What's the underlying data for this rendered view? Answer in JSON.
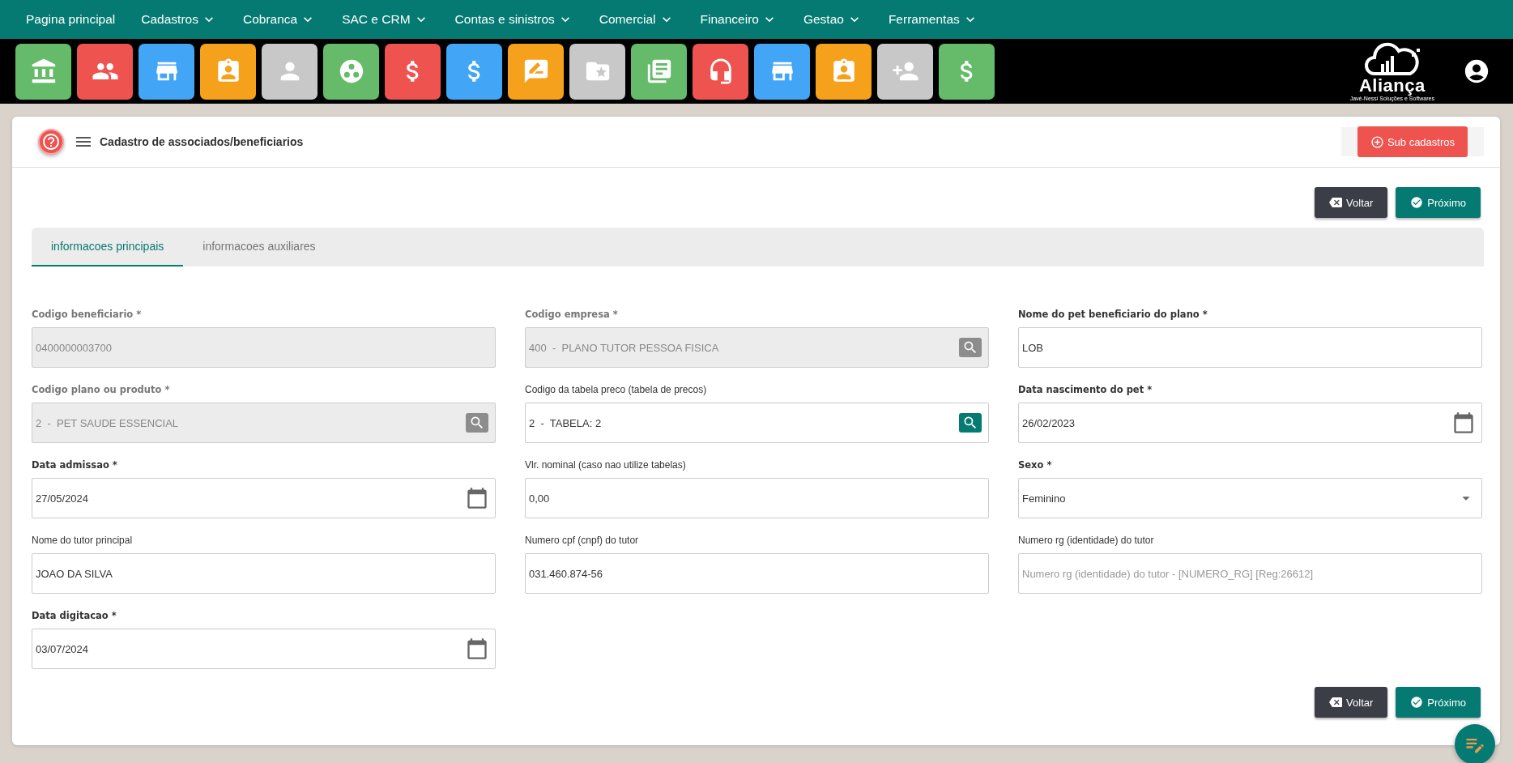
{
  "nav": [
    {
      "label": "Pagina principal",
      "has_dropdown": false
    },
    {
      "label": "Cadastros",
      "has_dropdown": true
    },
    {
      "label": "Cobranca",
      "has_dropdown": true
    },
    {
      "label": "SAC e CRM",
      "has_dropdown": true
    },
    {
      "label": "Contas e sinistros",
      "has_dropdown": true
    },
    {
      "label": "Comercial",
      "has_dropdown": true
    },
    {
      "label": "Financeiro",
      "has_dropdown": true
    },
    {
      "label": "Gestao",
      "has_dropdown": true
    },
    {
      "label": "Ferramentas",
      "has_dropdown": true
    }
  ],
  "toolbar": [
    {
      "color": "#66bb6a"
    },
    {
      "color": "#ef5350"
    },
    {
      "color": "#42a5f5"
    },
    {
      "color": "#f5a11c"
    },
    {
      "color": "#c8c8c8"
    },
    {
      "color": "#66bb6a"
    },
    {
      "color": "#ef5350"
    },
    {
      "color": "#42a5f5"
    },
    {
      "color": "#f5a11c"
    },
    {
      "color": "#c8c8c8"
    },
    {
      "color": "#66bb6a"
    },
    {
      "color": "#ef5350"
    },
    {
      "color": "#42a5f5"
    },
    {
      "color": "#f5a11c"
    },
    {
      "color": "#c8c8c8"
    },
    {
      "color": "#66bb6a"
    }
  ],
  "logo": {
    "name": "Aliança",
    "tagline": "Javé-Nessi Soluções e Softwares"
  },
  "header": {
    "title": "Cadastro de associados/beneficiarios",
    "action": "Sub cadastros"
  },
  "top_buttons": [
    {
      "label": "Voltar",
      "kind": "back"
    },
    {
      "label": "Próximo",
      "kind": "next"
    }
  ],
  "tabs": [
    {
      "label": "informacoes principais",
      "selected": true
    },
    {
      "label": "informacoes auxiliares",
      "selected": false
    }
  ],
  "fields": [
    {
      "label": "Codigo beneficiario *",
      "required": true,
      "disabled": true,
      "kind": "text",
      "value": "0400000003700"
    },
    {
      "label": "Codigo empresa *",
      "required": true,
      "disabled": true,
      "kind": "lookup",
      "value": "400  -  PLANO TUTOR PESSOA FISICA"
    },
    {
      "label": "Nome do pet beneficiario do plano *",
      "required": true,
      "disabled": false,
      "kind": "text",
      "value": "LOB"
    },
    {
      "label": "Codigo plano ou produto *",
      "required": true,
      "disabled": true,
      "kind": "lookup",
      "value": "2  -  PET SAUDE ESSENCIAL"
    },
    {
      "label": "Codigo da tabela preco (tabela de precos)",
      "required": false,
      "disabled": false,
      "kind": "lookup",
      "value": "2  -  TABELA: 2"
    },
    {
      "label": "Data nascimento do pet *",
      "required": true,
      "disabled": false,
      "kind": "date",
      "value": "26/02/2023"
    },
    {
      "label": "Data admissao *",
      "required": true,
      "disabled": false,
      "kind": "date",
      "value": "27/05/2024"
    },
    {
      "label": "Vlr. nominal (caso nao utilize tabelas)",
      "required": false,
      "disabled": false,
      "kind": "text",
      "value": "0,00"
    },
    {
      "label": "Sexo *",
      "required": true,
      "disabled": false,
      "kind": "select",
      "value": "Feminino"
    },
    {
      "label": "Nome do tutor principal",
      "required": false,
      "disabled": false,
      "kind": "text",
      "value": "JOAO DA SILVA"
    },
    {
      "label": "Numero cpf (cnpf) do tutor",
      "required": false,
      "disabled": false,
      "kind": "text",
      "value": "031.460.874-56"
    },
    {
      "label": "Numero rg (identidade) do tutor",
      "required": false,
      "disabled": false,
      "kind": "text",
      "placeholder": "Numero rg (identidade) do tutor - [NUMERO_RG] [Reg:26612]"
    },
    {
      "label": "Data digitacao *",
      "required": true,
      "disabled": false,
      "kind": "date",
      "value": "03/07/2024"
    }
  ],
  "bottom_buttons": [
    {
      "label": "Voltar",
      "kind": "back"
    },
    {
      "label": "Próximo",
      "kind": "next"
    }
  ]
}
